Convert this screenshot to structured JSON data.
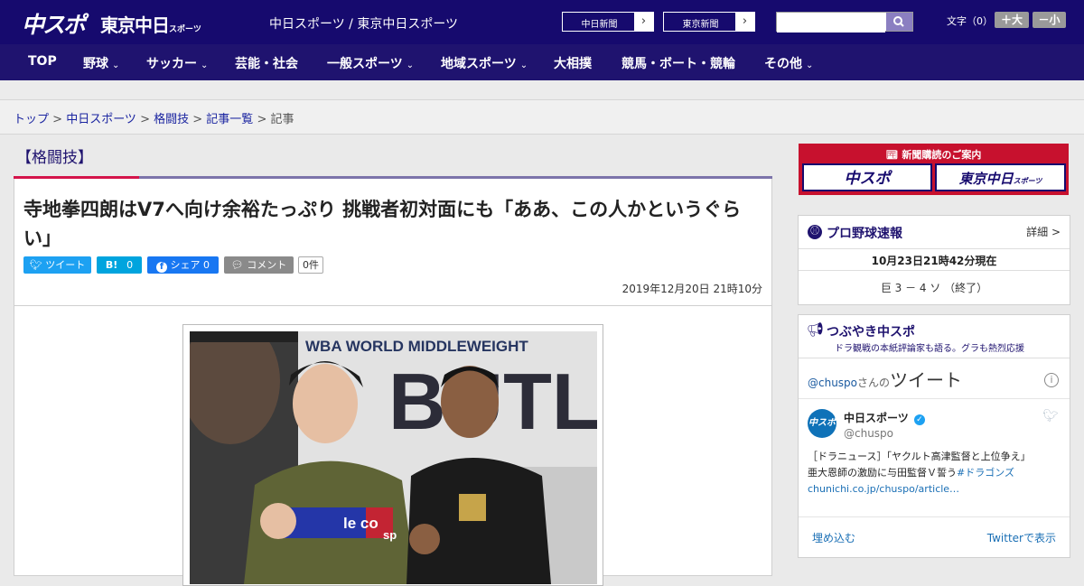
{
  "header": {
    "logo_chuspo": "中スポ",
    "logo_tokyo": "東京中日",
    "logo_tokyo_small": "スポーツ",
    "site_names": "中日スポーツ / 東京中日スポーツ",
    "paper_links": [
      "中日新聞",
      "東京新聞"
    ],
    "search_placeholder": "",
    "text_size_label": "文字（0）",
    "text_bigger": "＋大",
    "text_smaller": "－小"
  },
  "nav": {
    "items": [
      {
        "label": "TOP"
      },
      {
        "label": "野球"
      },
      {
        "label": "サッカー"
      },
      {
        "label": "芸能・社会"
      },
      {
        "label": "一般スポーツ"
      },
      {
        "label": "地域スポーツ"
      },
      {
        "label": "大相撲"
      },
      {
        "label": "競馬・ボート・競輪"
      },
      {
        "label": "その他"
      }
    ]
  },
  "breadcrumb": {
    "items": [
      "トップ",
      "中日スポーツ",
      "格闘技",
      "記事一覧"
    ],
    "current": "記事"
  },
  "article": {
    "category": "【格闘技】",
    "headline": "寺地拳四朗はV7へ向け余裕たっぷり 挑戦者初対面にも「ああ、この人かというぐらい」",
    "share": {
      "tweet": "ツイート",
      "hatena": "B!",
      "hatena_count": "0",
      "facebook": "シェア",
      "facebook_count": "0",
      "comment": "コメント",
      "comment_count": "0件"
    },
    "date": "2019年12月20日 21時10分",
    "photo": {
      "backdrop_text": "WBA WORLD MIDDLEWEIGHT",
      "backdrop_big": "BUTL",
      "jacket_text": "le co",
      "jacket_sub": "sp"
    }
  },
  "sidebar": {
    "subscribe": {
      "title": "新聞購読のご案内",
      "logos": [
        "中スポ",
        "東京中日"
      ],
      "logo_small": "スポーツ"
    },
    "baseball": {
      "title": "プロ野球速報",
      "detail": "詳細 >",
      "updated": "10月23日21時42分現在",
      "score": "巨 3 － 4 ソ （終了）"
    },
    "twitter": {
      "title": "つぶやき中スポ",
      "subtitle": "ドラ観戦の本紙評論家も語る。グラも熱烈応援",
      "handle_prefix": "@chuspo",
      "handle_suffix": "さんの",
      "tweet_word": "ツイート",
      "account_name": "中日スポーツ",
      "account_handle": "@chuspo",
      "tweet_text_1": "［ドラニュース］「ヤクルト高津監督と上位争え」",
      "tweet_text_2": "亜大恩師の激励に与田監督Ｖ誓う",
      "tweet_hashtag": "#ドラゴンズ",
      "tweet_link": "chunichi.co.jp/chuspo/article…",
      "embed": "埋め込む",
      "view_on_twitter": "Twitterで表示"
    }
  },
  "colors": {
    "header_bg": "#160a6e",
    "nav_bg": "#1f136f",
    "accent_red": "#d4144a",
    "twitter_blue": "#1da1f2",
    "facebook_blue": "#1877f2",
    "hatena_blue": "#00a4de"
  }
}
